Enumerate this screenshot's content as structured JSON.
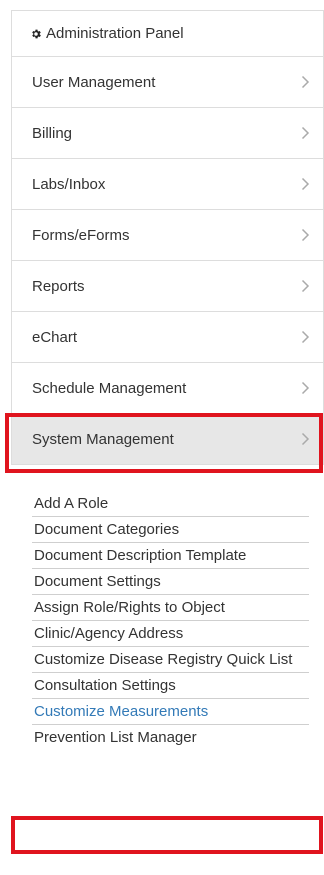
{
  "panel": {
    "heading": "Administration Panel",
    "heading_icon": "gear-icon",
    "items": [
      {
        "label": "User Management",
        "active": false
      },
      {
        "label": "Billing",
        "active": false
      },
      {
        "label": "Labs/Inbox",
        "active": false
      },
      {
        "label": "Forms/eForms",
        "active": false
      },
      {
        "label": "Reports",
        "active": false
      },
      {
        "label": "eChart",
        "active": false
      },
      {
        "label": "Schedule Management",
        "active": false
      },
      {
        "label": "System Management",
        "active": true
      }
    ]
  },
  "submenu": {
    "items": [
      {
        "label": "Add A Role"
      },
      {
        "label": "Document Categories"
      },
      {
        "label": "Document Description Template"
      },
      {
        "label": "Document Settings"
      },
      {
        "label": "Assign Role/Rights to Object"
      },
      {
        "label": "Clinic/Agency Address"
      },
      {
        "label": "Customize Disease Registry Quick List"
      },
      {
        "label": "Consultation Settings"
      },
      {
        "label": "Customize Measurements",
        "active": true
      },
      {
        "label": "Prevention List Manager"
      }
    ]
  },
  "colors": {
    "highlight": "#e0141e",
    "link_active": "#337ab7",
    "active_bg": "#e7e7e7"
  }
}
